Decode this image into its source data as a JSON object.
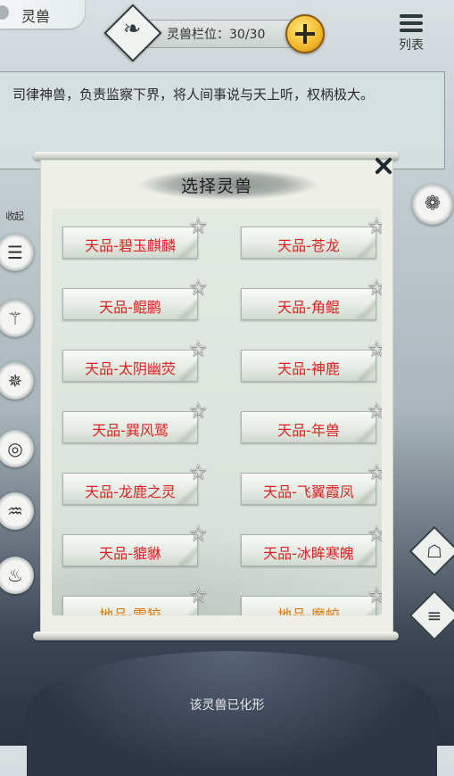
{
  "header": {
    "title": "灵兽",
    "slot_label": "灵兽栏位：30/30",
    "list_label": "列表"
  },
  "description": "司律神兽，负责监察下界，将人间事说与天上听，权柄极大。",
  "left_bar": {
    "label": "收起",
    "icons": [
      "scroll-icon",
      "dragon-claw-icon",
      "dragon-head-icon",
      "coil-icon",
      "fish-icon",
      "flame-icon"
    ]
  },
  "right_bar": {
    "icons": [
      "dragon-emblem-icon",
      "shrine-icon",
      "scroll-diamond-icon"
    ]
  },
  "modal": {
    "title": "选择灵兽",
    "items": [
      {
        "name": "天品-碧玉麒麟",
        "tier": "heaven"
      },
      {
        "name": "天品-苍龙",
        "tier": "heaven"
      },
      {
        "name": "天品-鲲鹏",
        "tier": "heaven"
      },
      {
        "name": "天品-角鲲",
        "tier": "heaven"
      },
      {
        "name": "天品-太阴幽荧",
        "tier": "heaven"
      },
      {
        "name": "天品-神鹿",
        "tier": "heaven"
      },
      {
        "name": "天品-巽风鹫",
        "tier": "heaven"
      },
      {
        "name": "天品-年兽",
        "tier": "heaven"
      },
      {
        "name": "天品-龙鹿之灵",
        "tier": "heaven"
      },
      {
        "name": "天品-飞翼霞凤",
        "tier": "heaven"
      },
      {
        "name": "天品-貔貅",
        "tier": "heaven"
      },
      {
        "name": "天品-冰眸寒魄",
        "tier": "heaven"
      },
      {
        "name": "地品-雷狡",
        "tier": "earth"
      },
      {
        "name": "地品-魔蛟",
        "tier": "earth"
      }
    ]
  },
  "footer_text": "该灵兽已化形",
  "colors": {
    "heaven_text": "#e02020",
    "earth_text": "#e07a10"
  }
}
